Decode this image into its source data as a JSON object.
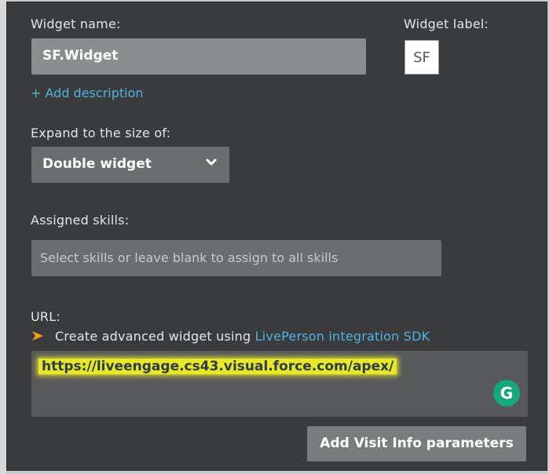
{
  "widget": {
    "name_label": "Widget name:",
    "name_value": "SF.Widget",
    "widget_label_title": "Widget label:",
    "widget_label_value": "SF",
    "add_description": "+ Add description"
  },
  "expand": {
    "label": "Expand to the size of:",
    "selected": "Double widget"
  },
  "skills": {
    "label": "Assigned skills:",
    "placeholder": "Select skills or leave blank to assign to all skills"
  },
  "url": {
    "label": "URL:",
    "hint_prefix": "Create advanced widget using",
    "hint_link": "LivePerson integration SDK",
    "value": "https://liveengage.cs43.visual.force.com/apex/"
  },
  "grammarly_glyph": "G",
  "buttons": {
    "add_visit_info": "Add Visit Info parameters"
  },
  "colors": {
    "panel_bg": "#3a3b3d",
    "link": "#4fb3e0",
    "highlight": "#e8e82a",
    "arrow": "#f2a218"
  }
}
